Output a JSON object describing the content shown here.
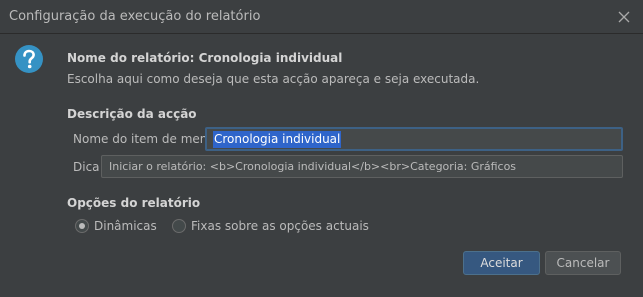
{
  "window": {
    "title": "Configuração da execução do relatório"
  },
  "header": {
    "icon": "help-question-icon",
    "title": "Nome do relatório: Cronologia individual",
    "subtitle": "Escolha aqui como deseja que esta acção apareça e seja executada."
  },
  "description_section": {
    "heading": "Descrição da acção",
    "menu_item_label": "Nome do item de menu",
    "menu_item_value": "Cronologia individual",
    "hint_label": "Dica",
    "hint_value": "Iniciar o relatório: <b>Cronologia individual</b><br>Categoria: Gráficos"
  },
  "options_section": {
    "heading": "Opções do relatório",
    "options": [
      {
        "label": "Dinâmicas",
        "selected": true
      },
      {
        "label": "Fixas sobre as opções actuais",
        "selected": false
      }
    ]
  },
  "buttons": {
    "accept": "Aceitar",
    "cancel": "Cancelar"
  },
  "colors": {
    "background": "#3c3f41",
    "accent": "#3592c4",
    "primary_button": "#365880",
    "selection": "#2f65ca"
  }
}
